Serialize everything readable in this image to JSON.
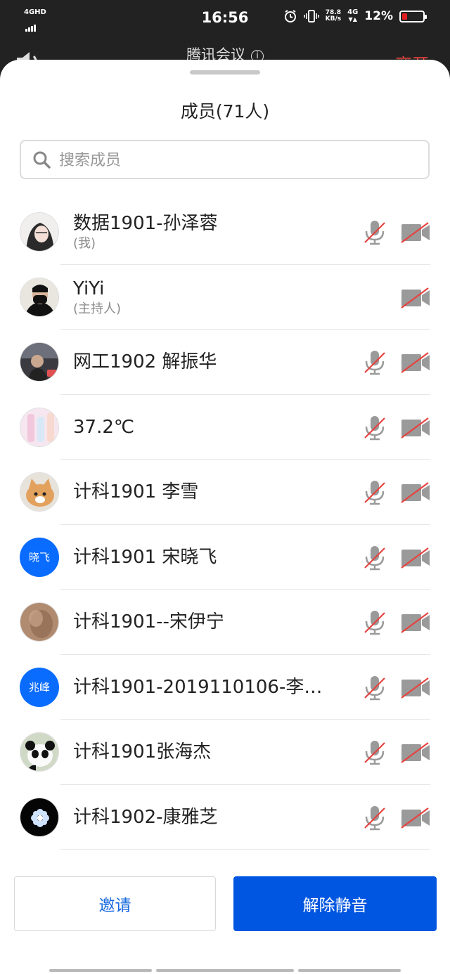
{
  "status_bar": {
    "network": "4GHD",
    "time": "16:56",
    "speed_value": "78.8",
    "speed_unit": "KB/s",
    "net_type": "4G",
    "battery": "12%",
    "battery_level": 0.12,
    "battery_color": "#e02020"
  },
  "meeting": {
    "title": "腾讯会议",
    "leave_label": "离开"
  },
  "sheet": {
    "title": "成员(71人)",
    "search_placeholder": "搜索成员"
  },
  "members": [
    {
      "name": "数据1901-孙泽蓉",
      "role": "(我)",
      "avatar": "photo-woman",
      "mic": "muted",
      "camera": "off"
    },
    {
      "name": "YiYi",
      "role": "(主持人)",
      "avatar": "photo-masked",
      "mic": "none",
      "camera": "off"
    },
    {
      "name": " 网工1902 解振华",
      "role": "",
      "avatar": "photo-dark",
      "mic": "muted",
      "camera": "off"
    },
    {
      "name": "37.2℃",
      "role": "",
      "avatar": "photo-pastel",
      "mic": "muted",
      "camera": "off"
    },
    {
      "name": "计科1901 李雪",
      "role": "",
      "avatar": "photo-cat",
      "mic": "muted",
      "camera": "off"
    },
    {
      "name": "计科1901 宋晓飞",
      "role": "",
      "avatar_text": "晓飞",
      "mic": "muted",
      "camera": "off"
    },
    {
      "name": "计科1901--宋伊宁",
      "role": "",
      "avatar": "photo-brown",
      "mic": "muted",
      "camera": "off"
    },
    {
      "name": "计科1901-2019110106-李…",
      "role": "",
      "avatar_text": "兆峰",
      "mic": "muted",
      "camera": "off"
    },
    {
      "name": "计科1901张海杰",
      "role": "",
      "avatar": "photo-panda",
      "mic": "muted",
      "camera": "off"
    },
    {
      "name": "计科1902-康雅芝",
      "role": "",
      "avatar": "photo-flower",
      "mic": "muted",
      "camera": "off"
    }
  ],
  "actions": {
    "invite_label": "邀请",
    "unmute_label": "解除静音"
  },
  "colors": {
    "accent": "#0056e0",
    "link": "#1a6be0",
    "muted_slash": "#e64340",
    "avatar_blue": "#0a6cff"
  }
}
